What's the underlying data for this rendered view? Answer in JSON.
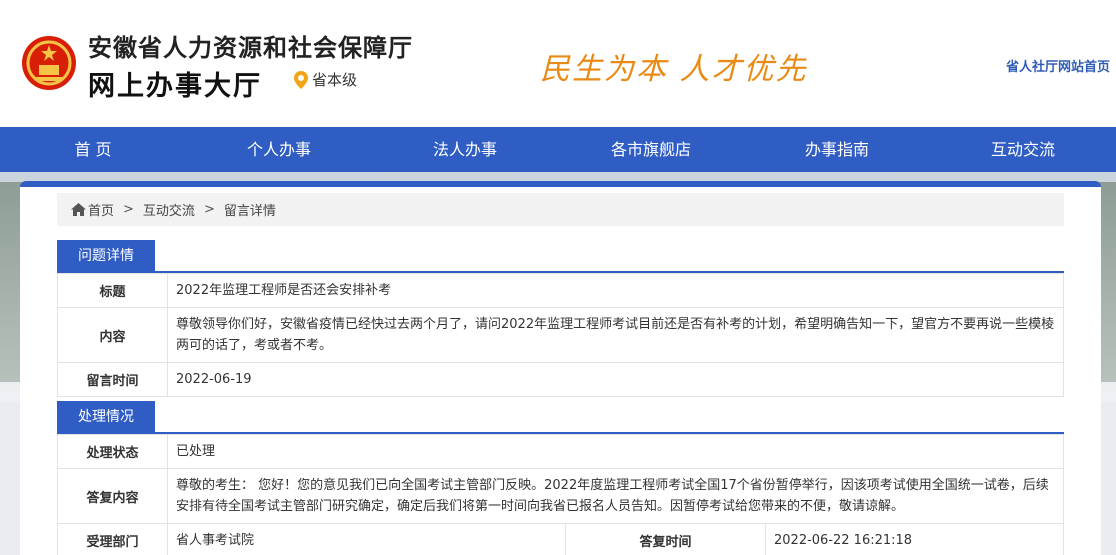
{
  "header": {
    "title_main": "安徽省人力资源和社会保障厅",
    "title_sub": "网上办事大厅",
    "level": "省本级",
    "slogan": "民生为本  人才优先",
    "home_link": "省人社厅网站首页",
    "accent_color": "#2f5dc3",
    "slogan_color": "#e98a14"
  },
  "nav": {
    "items": [
      "首 页",
      "个人办事",
      "法人办事",
      "各市旗舰店",
      "办事指南",
      "互动交流"
    ]
  },
  "breadcrumb": {
    "home": "首页",
    "level1": "互动交流",
    "level2": "留言详情",
    "separator": ">"
  },
  "question": {
    "section_title": "问题详情",
    "title_label": "标题",
    "title_value": "2022年监理工程师是否还会安排补考",
    "content_label": "内容",
    "content_value": "尊敬领导你们好，安徽省疫情已经快过去两个月了，请问2022年监理工程师考试目前还是否有补考的计划，希望明确告知一下，望官方不要再说一些模棱两可的话了，考或者不考。",
    "time_label": "留言时间",
    "time_value": "2022-06-19"
  },
  "handling": {
    "section_title": "处理情况",
    "status_label": "处理状态",
    "status_value": "已处理",
    "reply_label": "答复内容",
    "reply_value": "尊敬的考生： 您好！您的意见我们已向全国考试主管部门反映。2022年度监理工程师考试全国17个省份暂停举行，因该项考试使用全国统一试卷，后续安排有待全国考试主管部门研究确定，确定后我们将第一时间向我省已报名人员告知。因暂停考试给您带来的不便，敬请谅解。",
    "dept_label": "受理部门",
    "dept_value": "省人事考试院",
    "reply_time_label": "答复时间",
    "reply_time_value": "2022-06-22 16:21:18"
  }
}
